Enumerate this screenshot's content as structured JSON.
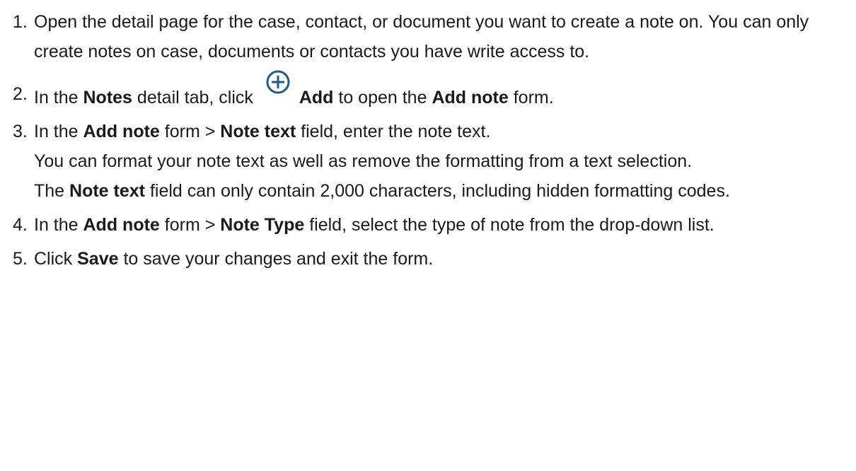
{
  "steps": [
    {
      "number": "1.",
      "text": "Open the detail page for the case, contact, or document you want to create a note on. You can only create notes on case, documents or contacts you have write access to."
    },
    {
      "number": "2.",
      "t1": "In the ",
      "b1": "Notes",
      "t2": " detail tab, click ",
      "icon": "add-circle-icon",
      "b2": "Add",
      "t3": " to open the ",
      "b3": "Add note",
      "t4": " form."
    },
    {
      "number": "3.",
      "t1": "In the ",
      "b1": "Add note",
      "t2": " form > ",
      "b2": "Note text",
      "t3": " field, enter the note text.",
      "p2": "You can format your note text as well as remove the formatting from a text selection.",
      "p3_t1": "The ",
      "p3_b1": "Note text",
      "p3_t2": " field can only contain 2,000 characters, including hidden formatting codes."
    },
    {
      "number": "4.",
      "t1": "In the ",
      "b1": "Add note",
      "t2": " form > ",
      "b2": "Note Type",
      "t3": " field, select the type of note from the drop-down list."
    },
    {
      "number": "5.",
      "t1": "Click ",
      "b1": "Save",
      "t2": " to save your changes and exit the form."
    }
  ]
}
